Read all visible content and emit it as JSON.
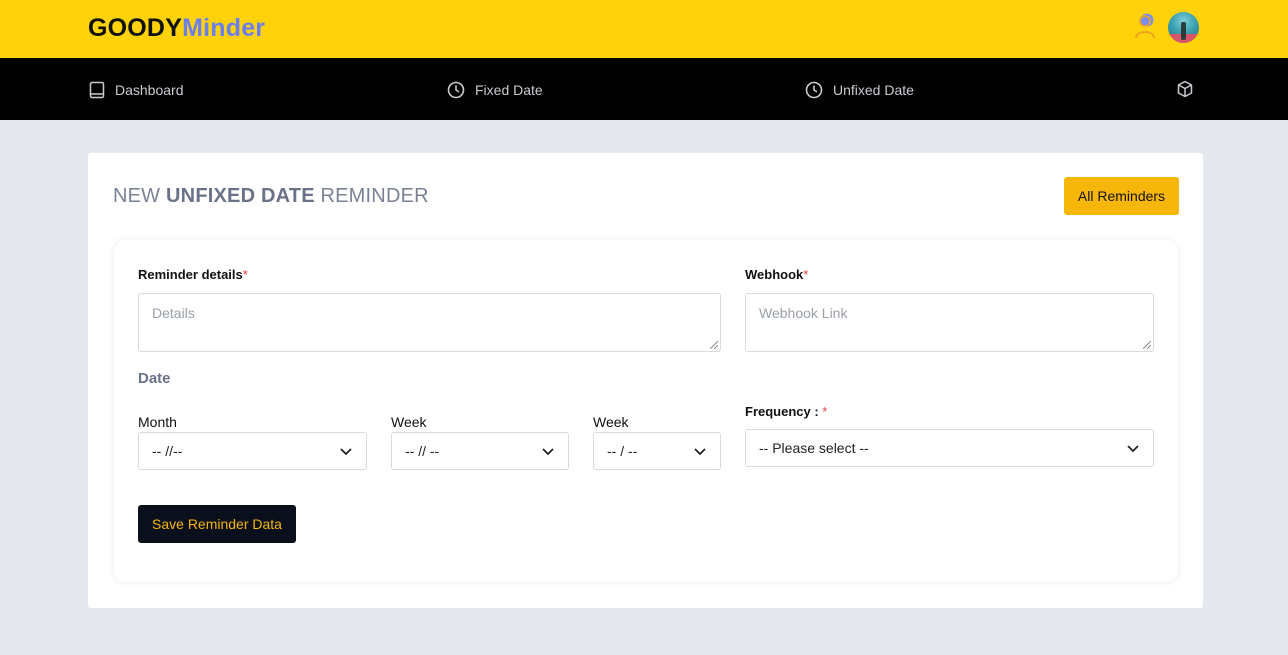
{
  "header": {
    "logo_part1": "GOODY",
    "logo_part2": "Minder"
  },
  "nav": {
    "items": [
      {
        "label": "Dashboard",
        "icon": "book-icon"
      },
      {
        "label": "Fixed Date",
        "icon": "clock-icon"
      },
      {
        "label": "Unfixed Date",
        "icon": "clock-icon"
      }
    ],
    "extra_icon": "cube-icon"
  },
  "page": {
    "title_prefix": "NEW",
    "title_bold": "UNFIXED DATE",
    "title_suffix": "REMINDER",
    "all_reminders_label": "All Reminders"
  },
  "form": {
    "details_label": "Reminder details",
    "details_placeholder": "Details",
    "webhook_label": "Webhook",
    "webhook_placeholder": "Webhook Link",
    "required_mark": "*",
    "date_label": "Date",
    "month_label": "Month",
    "month_value": "-- //--",
    "week1_label": "Week",
    "week1_value": "-- // --",
    "week2_label": "Week",
    "week2_value": "-- / --",
    "frequency_label": "Frequency : ",
    "frequency_value": "-- Please select --",
    "save_label": "Save Reminder Data"
  },
  "colors": {
    "topbar": "#ffd20a",
    "navbar": "#000000",
    "accent": "#f6b60a",
    "logo_secondary": "#6b7ff0"
  }
}
